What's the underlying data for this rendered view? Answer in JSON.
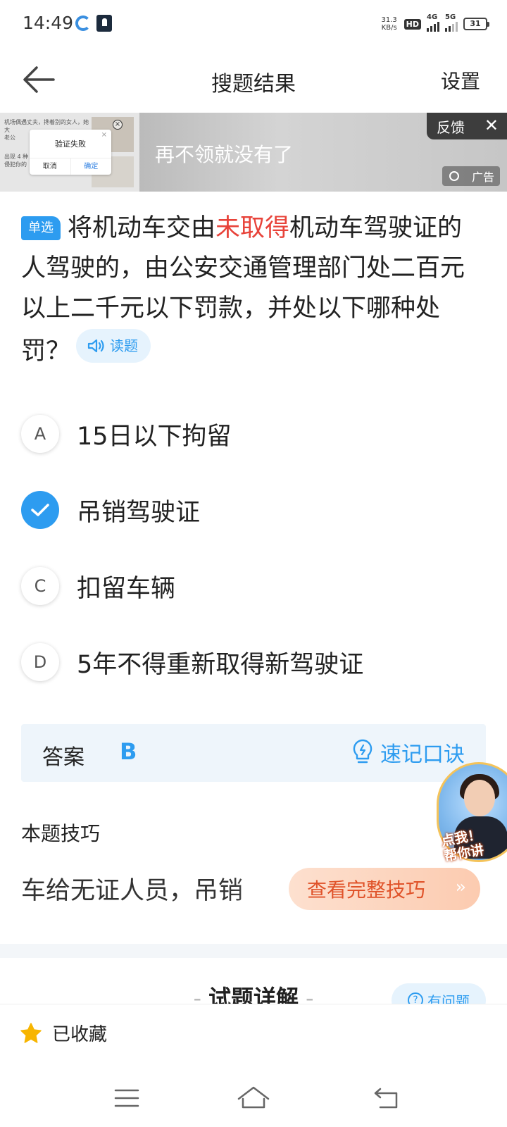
{
  "status_bar": {
    "time": "14:49",
    "net_speed_value": "31.3",
    "net_speed_unit": "KB/s",
    "hd_label": "HD",
    "sim1_label": "4G",
    "sim2_label": "5G",
    "battery": "31"
  },
  "header": {
    "title": "搜题结果",
    "settings_label": "设置"
  },
  "ad": {
    "dialog_title": "验证失败",
    "dialog_cancel": "取消",
    "dialog_confirm": "确定",
    "thumb_text_1": "机场偶遇丈夫，搀着别的女人，她大",
    "thumb_text_2": "老公",
    "thumb_text_3": "出现 4 种",
    "thumb_text_4": "侵犯你的",
    "headline": "再不领就没有了",
    "feedback_label": "反馈",
    "ad_tag_label": "广告"
  },
  "question": {
    "type_label": "单选",
    "text_before": "将机动车交由",
    "text_highlight": "未取得",
    "text_after": "机动车驾驶证的人驾驶的，由公安交通管理部门处二百元以上二千元以下罚款，并处以下哪种处罚？",
    "read_label": "读题"
  },
  "options": [
    {
      "letter": "A",
      "text": "15日以下拘留",
      "selected": false
    },
    {
      "letter": "B",
      "text": "吊销驾驶证",
      "selected": true
    },
    {
      "letter": "C",
      "text": "扣留车辆",
      "selected": false
    },
    {
      "letter": "D",
      "text": "5年不得重新取得新驾驶证",
      "selected": false
    }
  ],
  "answer": {
    "label": "答案",
    "value": "B",
    "mnemonic_label": "速记口诀"
  },
  "teacher": {
    "bubble_text_1": "点我！",
    "bubble_text_2": "帮你讲"
  },
  "tip": {
    "title": "本题技巧",
    "content": "车给无证人员，吊销",
    "view_full_label": "查看完整技巧"
  },
  "explanation": {
    "title": "试题详解",
    "ask_label": "有问题"
  },
  "bottom": {
    "favorite_label": "已收藏"
  },
  "colors": {
    "accent": "#2d9cf0",
    "highlight": "#e8433a",
    "tip_button_text": "#e0532a",
    "star": "#f7b500"
  }
}
